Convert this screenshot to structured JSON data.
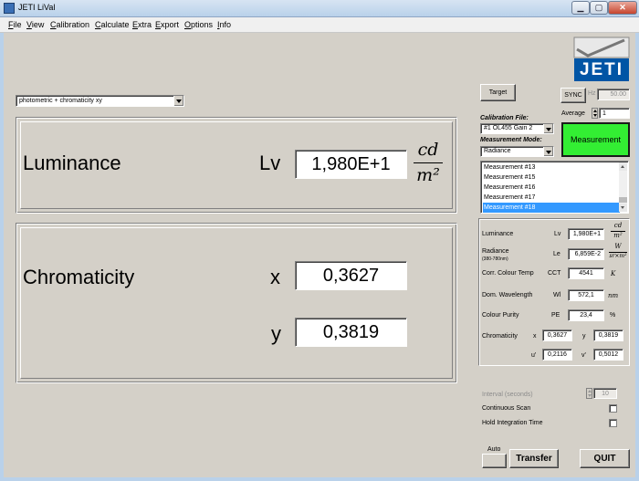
{
  "window": {
    "title": "JETI LiVal",
    "minimize": "▁",
    "maximize": "▢",
    "close": "✕"
  },
  "menu": [
    "File",
    "View",
    "Calibration",
    "Calculate",
    "Extra",
    "Export",
    "Options",
    "Info"
  ],
  "mode_select": "photometric + chromaticity xy",
  "luminance_panel": {
    "label": "Luminance",
    "symbol": "Lv",
    "value": "1,980E+1",
    "unit_num": "cd",
    "unit_den": "m²"
  },
  "chromaticity_panel": {
    "label": "Chromaticity",
    "x_symbol": "x",
    "x_value": "0,3627",
    "y_symbol": "y",
    "y_value": "0,3819"
  },
  "target_button": "Target",
  "sync_button": "SYNC",
  "hz_label": "Hz",
  "hz_value": "50.00",
  "calibration": {
    "label": "Calibration File:",
    "value": "#1  OL455 Gain 2"
  },
  "average": {
    "label": "Average",
    "value": "1"
  },
  "measurement_mode": {
    "label": "Measurement Mode:",
    "value": "Radiance"
  },
  "measurement_button": "Measurement",
  "measurements": [
    "Measurement #13",
    "Measurement #15",
    "Measurement #16",
    "Measurement #17",
    "Measurement #18"
  ],
  "selected_measurement_index": 4,
  "results": {
    "luminance": {
      "label": "Luminance",
      "symbol": "Lv",
      "value": "1,980E+1",
      "unit_num": "cd",
      "unit_den": "m²"
    },
    "radiance": {
      "label": "Radiance",
      "sub": "(380-780nm)",
      "symbol": "Le",
      "value": "6,859E-2",
      "unit_num": "W",
      "unit_den": "sr×m²"
    },
    "cct": {
      "label": "Corr. Colour Temp",
      "symbol": "CCT",
      "value": "4541",
      "unit": "K"
    },
    "wavelength": {
      "label": "Dom. Wavelength",
      "symbol": "Wl",
      "value": "572,1",
      "unit": "nm"
    },
    "purity": {
      "label": "Colour Purity",
      "symbol": "PE",
      "value": "23,4",
      "unit": "%"
    },
    "chromaticity": {
      "label": "Chromaticity",
      "x_sym": "x",
      "x": "0,3627",
      "y_sym": "y",
      "y": "0,3819",
      "u_sym": "u'",
      "u": "0,2116",
      "v_sym": "v'",
      "v": "0,5012"
    }
  },
  "interval": {
    "label": "Interval  (seconds)",
    "value": "10"
  },
  "continuous_scan": "Continuous Scan",
  "hold_integration": "Hold Integration Time",
  "auto_label": "Auto",
  "transfer_button": "Transfer",
  "quit_button": "QUIT",
  "logo_text": "JETI",
  "colors": {
    "measurement_green": "#33ee33",
    "selection_blue": "#3399ff",
    "logo_blue": "#0055a5"
  }
}
